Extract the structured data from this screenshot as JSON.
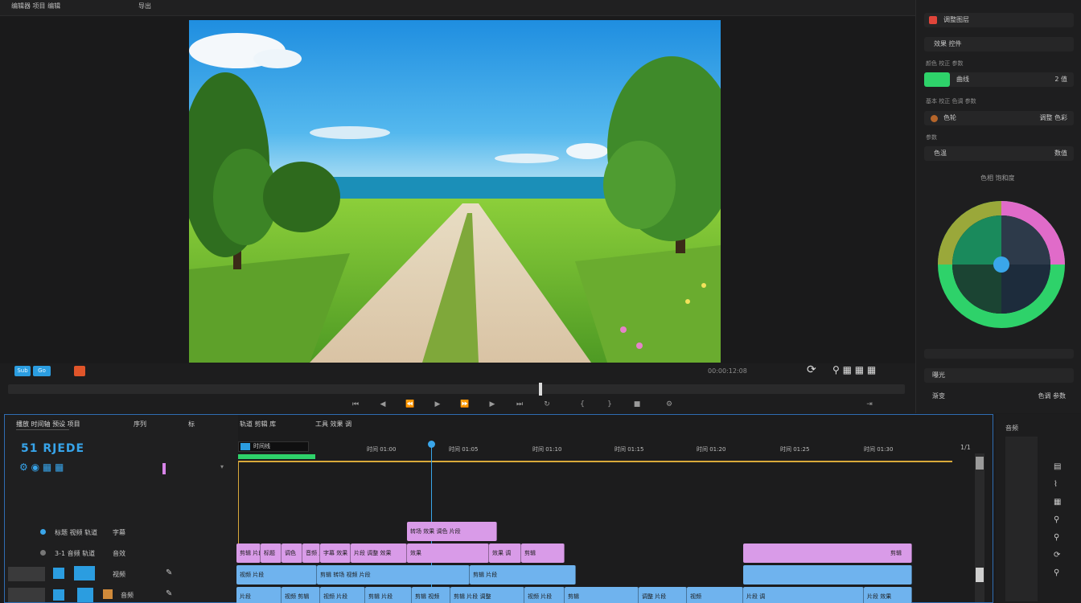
{
  "topbar": {
    "tab1": "编辑器 项目 编辑",
    "tab2": "导出"
  },
  "inspector": {
    "row1": "调整图层",
    "row2": "效果 控件",
    "label1": "颜色 校正 参数",
    "row3": "曲线",
    "row3_val": "2 值",
    "label2": "基本 校正 色调 参数",
    "row4": "色轮",
    "row4_val": "调整 色彩",
    "label3": "参数",
    "row5": "色温",
    "row5_val": "数值",
    "wheel_title": "色相 饱和度",
    "row6": "曝光",
    "row7": "渐变",
    "row7_val": "色调 参数",
    "accent_red": "#e0453a",
    "accent_green": "#2ed26a"
  },
  "transport": {
    "chip1": "Sub",
    "chip2": "Go",
    "timecode": "00:00:12:08"
  },
  "timeline": {
    "title": "播放 时间轴 预设 项目",
    "tab1": "序列",
    "tab2": "标",
    "tab3": "轨道 剪辑 库",
    "tab4": "工具 效果 调",
    "code": "51 RJEDE",
    "seq_tag": "时间线",
    "ticks": [
      "时间 01:00",
      "时间 01:05",
      "时间 01:10",
      "时间 01:15",
      "时间 01:20",
      "时间 01:25",
      "时间 01:30"
    ],
    "end_tick": "1/1",
    "tracks": [
      {
        "name": "标题 视频 轨道",
        "sub": "字幕"
      },
      {
        "name": "3-1 音频 轨道",
        "sub": "音效"
      },
      {
        "name": "视频 轨道",
        "sub": "视频"
      },
      {
        "name": "音频 轨道",
        "sub": "音频"
      }
    ],
    "clips_row1": [
      "转场 效果 调色 片段"
    ],
    "clips_row2": [
      "剪辑 片段",
      "标题",
      "调色",
      "音频 片段",
      "字幕 效果",
      "片段 调整 效果",
      "效果",
      "效果 调",
      "剪辑"
    ],
    "clips_row3": [
      "视频 片段",
      "剪辑 转场 视频 片段",
      "剪辑 片段"
    ],
    "clips_row4": [
      "片段",
      "视频 剪辑",
      "视频 片段",
      "剪辑 片段",
      "剪辑 视频",
      "剪辑 片段 调整",
      "视频 片段",
      "剪辑",
      "调整 片段",
      "视频",
      "片段 调",
      "片段 效果"
    ]
  },
  "rightdock": {
    "title": "音频"
  }
}
